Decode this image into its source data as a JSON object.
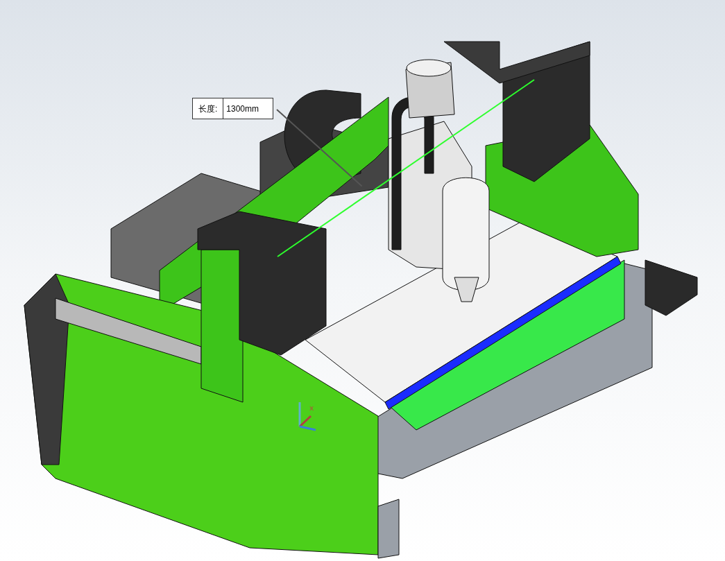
{
  "measure_tooltip": {
    "label": "长度:",
    "value": "1300mm"
  },
  "triad": {
    "axis_label": "X"
  }
}
